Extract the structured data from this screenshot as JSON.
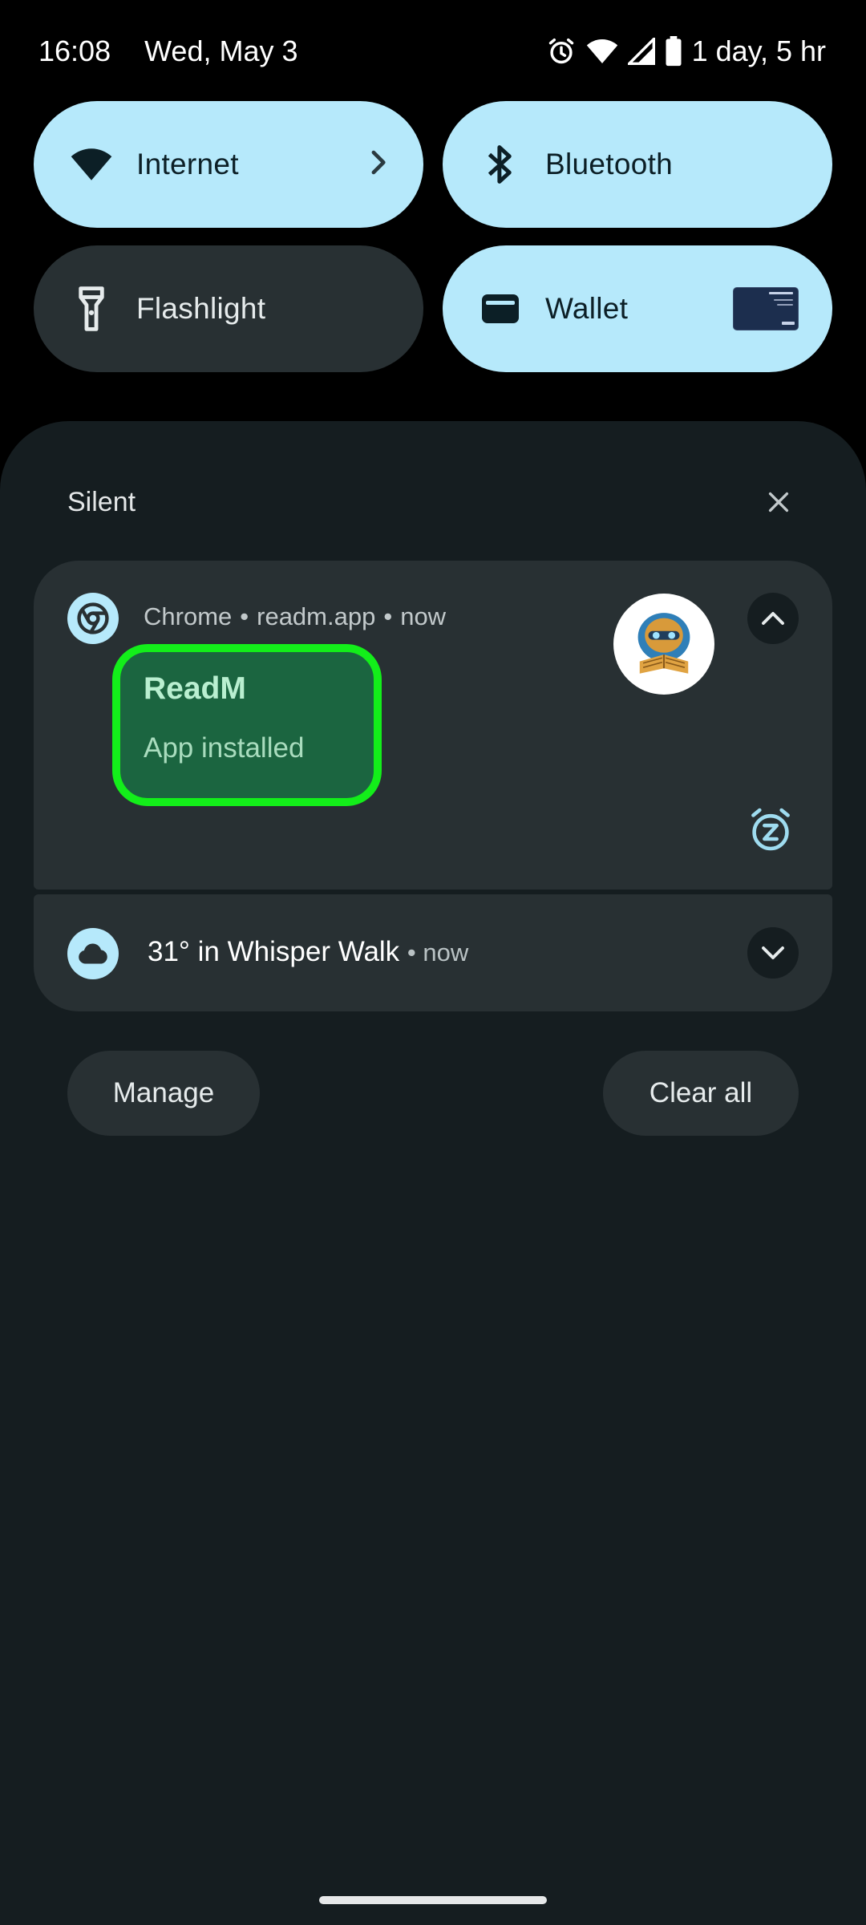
{
  "status_bar": {
    "time": "16:08",
    "date": "Wed, May 3",
    "battery_text": "1 day, 5 hr",
    "icons": [
      "alarm-icon",
      "wifi-icon",
      "cell-signal-icon",
      "battery-icon"
    ]
  },
  "quick_settings": {
    "tiles": [
      {
        "label": "Internet",
        "state": "on",
        "icon": "wifi-icon",
        "has_chevron": true
      },
      {
        "label": "Bluetooth",
        "state": "on",
        "icon": "bluetooth-icon"
      },
      {
        "label": "Flashlight",
        "state": "off",
        "icon": "flashlight-icon"
      },
      {
        "label": "Wallet",
        "state": "on",
        "icon": "wallet-icon",
        "has_card": true
      }
    ]
  },
  "shade": {
    "section_label": "Silent",
    "notifications": [
      {
        "app_name": "Chrome",
        "source": "readm.app",
        "time": "now",
        "title": "ReadM",
        "text": "App installed",
        "icon": "chrome-icon",
        "expanded": true
      },
      {
        "title": "31° in Whisper Walk",
        "time": "now",
        "icon": "cloud-icon",
        "expanded": false
      }
    ],
    "manage_label": "Manage",
    "clear_all_label": "Clear all"
  },
  "colors": {
    "tile_on": "#b6e9fb",
    "tile_off": "#283033",
    "shade_bg": "#151d20",
    "highlight_border": "#13ee1a",
    "highlight_fill": "#1b6540"
  },
  "separator_dot": "•"
}
